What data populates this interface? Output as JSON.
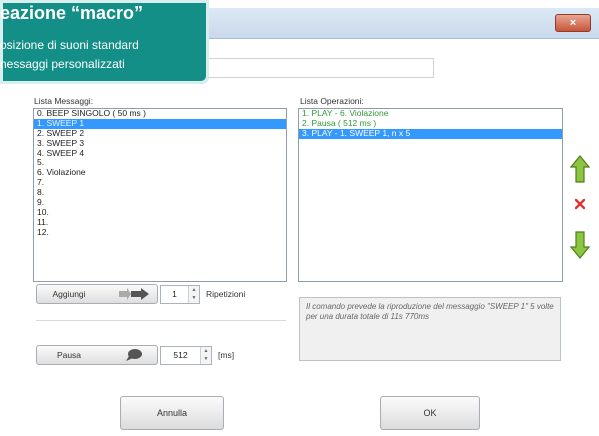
{
  "callout": {
    "heading": "eazione “macro”",
    "line1": "osizione di suoni standard",
    "line2": "nessaggi personalizzati"
  },
  "window": {
    "close_label": "×"
  },
  "messages": {
    "label": "Lista Messaggi:",
    "items": [
      {
        "label": "0. BEEP SINGOLO ( 50 ms )",
        "selected": false
      },
      {
        "label": "1. SWEEP 1",
        "selected": true
      },
      {
        "label": "2. SWEEP 2",
        "selected": false
      },
      {
        "label": "3. SWEEP 3",
        "selected": false
      },
      {
        "label": "4. SWEEP 4",
        "selected": false
      },
      {
        "label": "5.",
        "selected": false
      },
      {
        "label": "6. Violazione",
        "selected": false
      },
      {
        "label": "7.",
        "selected": false
      },
      {
        "label": "8.",
        "selected": false
      },
      {
        "label": "9.",
        "selected": false
      },
      {
        "label": "10.",
        "selected": false
      },
      {
        "label": "11.",
        "selected": false
      },
      {
        "label": "12.",
        "selected": false
      }
    ]
  },
  "operations": {
    "label": "Lista Operazioni:",
    "items": [
      {
        "label": "1. PLAY - 6. Violazione",
        "selected": false
      },
      {
        "label": "2. Pausa ( 512 ms )",
        "selected": false
      },
      {
        "label": "3. PLAY - 1. SWEEP 1, n x 5",
        "selected": true
      }
    ],
    "description": "Il comando prevede la riproduzione del messaggio \"SWEEP 1\" 5 volte per una durata totale di 11s 770ms"
  },
  "add": {
    "label": "Aggiungi",
    "repeat_value": "1",
    "repeat_label": "Ripetizioni"
  },
  "pause": {
    "label": "Pausa",
    "value": "512",
    "unit": "[ms]"
  },
  "footer": {
    "cancel_label": "Annulla",
    "ok_label": "OK"
  },
  "icons": {
    "move_up": "arrow-up-icon",
    "delete": "delete-x-icon",
    "move_down": "arrow-down-icon"
  },
  "colors": {
    "selection": "#3399ff",
    "operation_text": "#2e9a35",
    "callout_bg": "#138f88"
  }
}
